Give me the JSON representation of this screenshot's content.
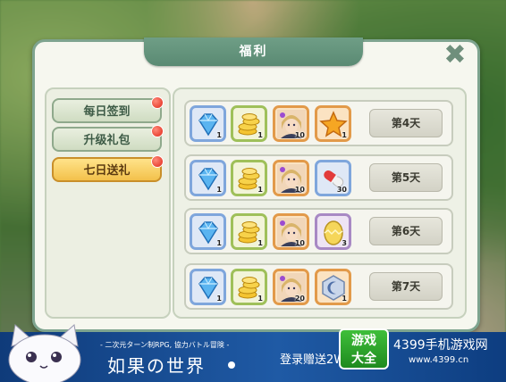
{
  "dialog": {
    "title": "福利",
    "close_icon": "close-x-icon"
  },
  "sidebar": {
    "items": [
      {
        "label": "每日签到",
        "active": false,
        "has_notification": true
      },
      {
        "label": "升级礼包",
        "active": false,
        "has_notification": true
      },
      {
        "label": "七日送礼",
        "active": true,
        "has_notification": true
      }
    ]
  },
  "rewards": {
    "rows": [
      {
        "day": "第4天",
        "items": [
          {
            "icon": "diamond-icon",
            "qty": "1"
          },
          {
            "icon": "gold-coins-icon",
            "qty": "1"
          },
          {
            "icon": "character-portrait-icon",
            "qty": "10"
          },
          {
            "icon": "star-icon",
            "qty": "1"
          }
        ]
      },
      {
        "day": "第5天",
        "items": [
          {
            "icon": "diamond-icon",
            "qty": "1"
          },
          {
            "icon": "gold-coins-icon",
            "qty": "1"
          },
          {
            "icon": "character-portrait-icon",
            "qty": "10"
          },
          {
            "icon": "capsule-icon",
            "qty": "30"
          }
        ]
      },
      {
        "day": "第6天",
        "items": [
          {
            "icon": "diamond-icon",
            "qty": "1"
          },
          {
            "icon": "gold-coins-icon",
            "qty": "1"
          },
          {
            "icon": "character-portrait-icon",
            "qty": "10"
          },
          {
            "icon": "golden-egg-icon",
            "qty": "3"
          }
        ]
      },
      {
        "day": "第7天",
        "items": [
          {
            "icon": "diamond-icon",
            "qty": "1"
          },
          {
            "icon": "gold-coins-icon",
            "qty": "1"
          },
          {
            "icon": "character-portrait-icon",
            "qty": "20"
          },
          {
            "icon": "moon-gem-icon",
            "qty": "1"
          }
        ]
      }
    ]
  },
  "banner": {
    "slogan": "- 二次元ターン制RPG, 協力バトル冒険 -",
    "game_name": "如果の世界",
    "promo": "登录赠送2W",
    "logo_text_top": "游戏",
    "logo_text_bottom": "大全",
    "brand": "4399手机游戏网",
    "url": "www.4399.cn"
  }
}
